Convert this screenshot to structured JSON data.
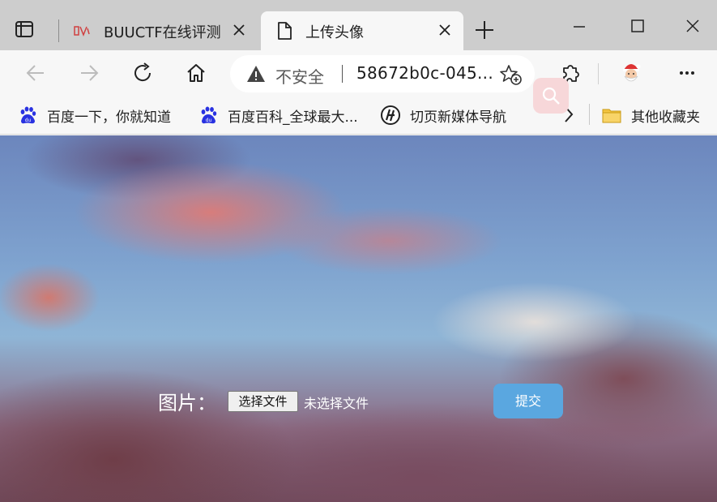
{
  "tabs": [
    {
      "title": "BUUCTF在线评测",
      "active": false,
      "favicon": "buuctf-favicon"
    },
    {
      "title": "上传头像",
      "active": true,
      "favicon": "document-icon"
    }
  ],
  "address_bar": {
    "security_text": "不安全",
    "url": "58672b0c-045..."
  },
  "favorites": [
    {
      "label": "百度一下，你就知道",
      "icon": "baidu-paw-icon"
    },
    {
      "label": "百度百科_全球最大...",
      "icon": "baidu-paw-icon"
    },
    {
      "label": "切页新媒体导航",
      "icon": "qieye-icon"
    },
    {
      "label": "其他收藏夹",
      "icon": "folder-icon"
    }
  ],
  "upload_form": {
    "label": "图片：",
    "file_button": "选择文件",
    "file_status": "未选择文件",
    "submit": "提交"
  },
  "colors": {
    "tabstrip": "#cdcdcd",
    "toolbar": "#f7f7f7",
    "submit_button": "#5aa7e0",
    "baidu_blue": "#2932e1"
  }
}
